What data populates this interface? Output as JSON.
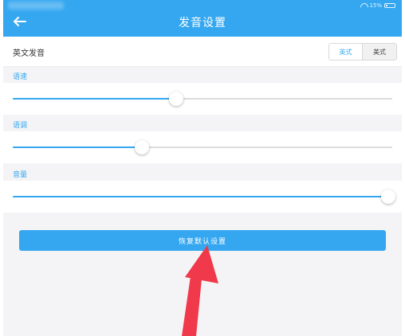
{
  "status_bar": {
    "battery_text": "15%",
    "battery_level": 0.15
  },
  "nav": {
    "title": "发音设置",
    "back_icon": "arrow-left-icon"
  },
  "pronunciation": {
    "label": "英文发音",
    "options": [
      "英式",
      "美式"
    ],
    "selected": "英式"
  },
  "sliders": [
    {
      "label": "语速",
      "value": 0.43
    },
    {
      "label": "语调",
      "value": 0.34
    },
    {
      "label": "音量",
      "value": 1.0
    }
  ],
  "restore_button": {
    "label": "恢复默认设置"
  },
  "colors": {
    "accent": "#34a7f0",
    "annotation": "#f0394a"
  }
}
